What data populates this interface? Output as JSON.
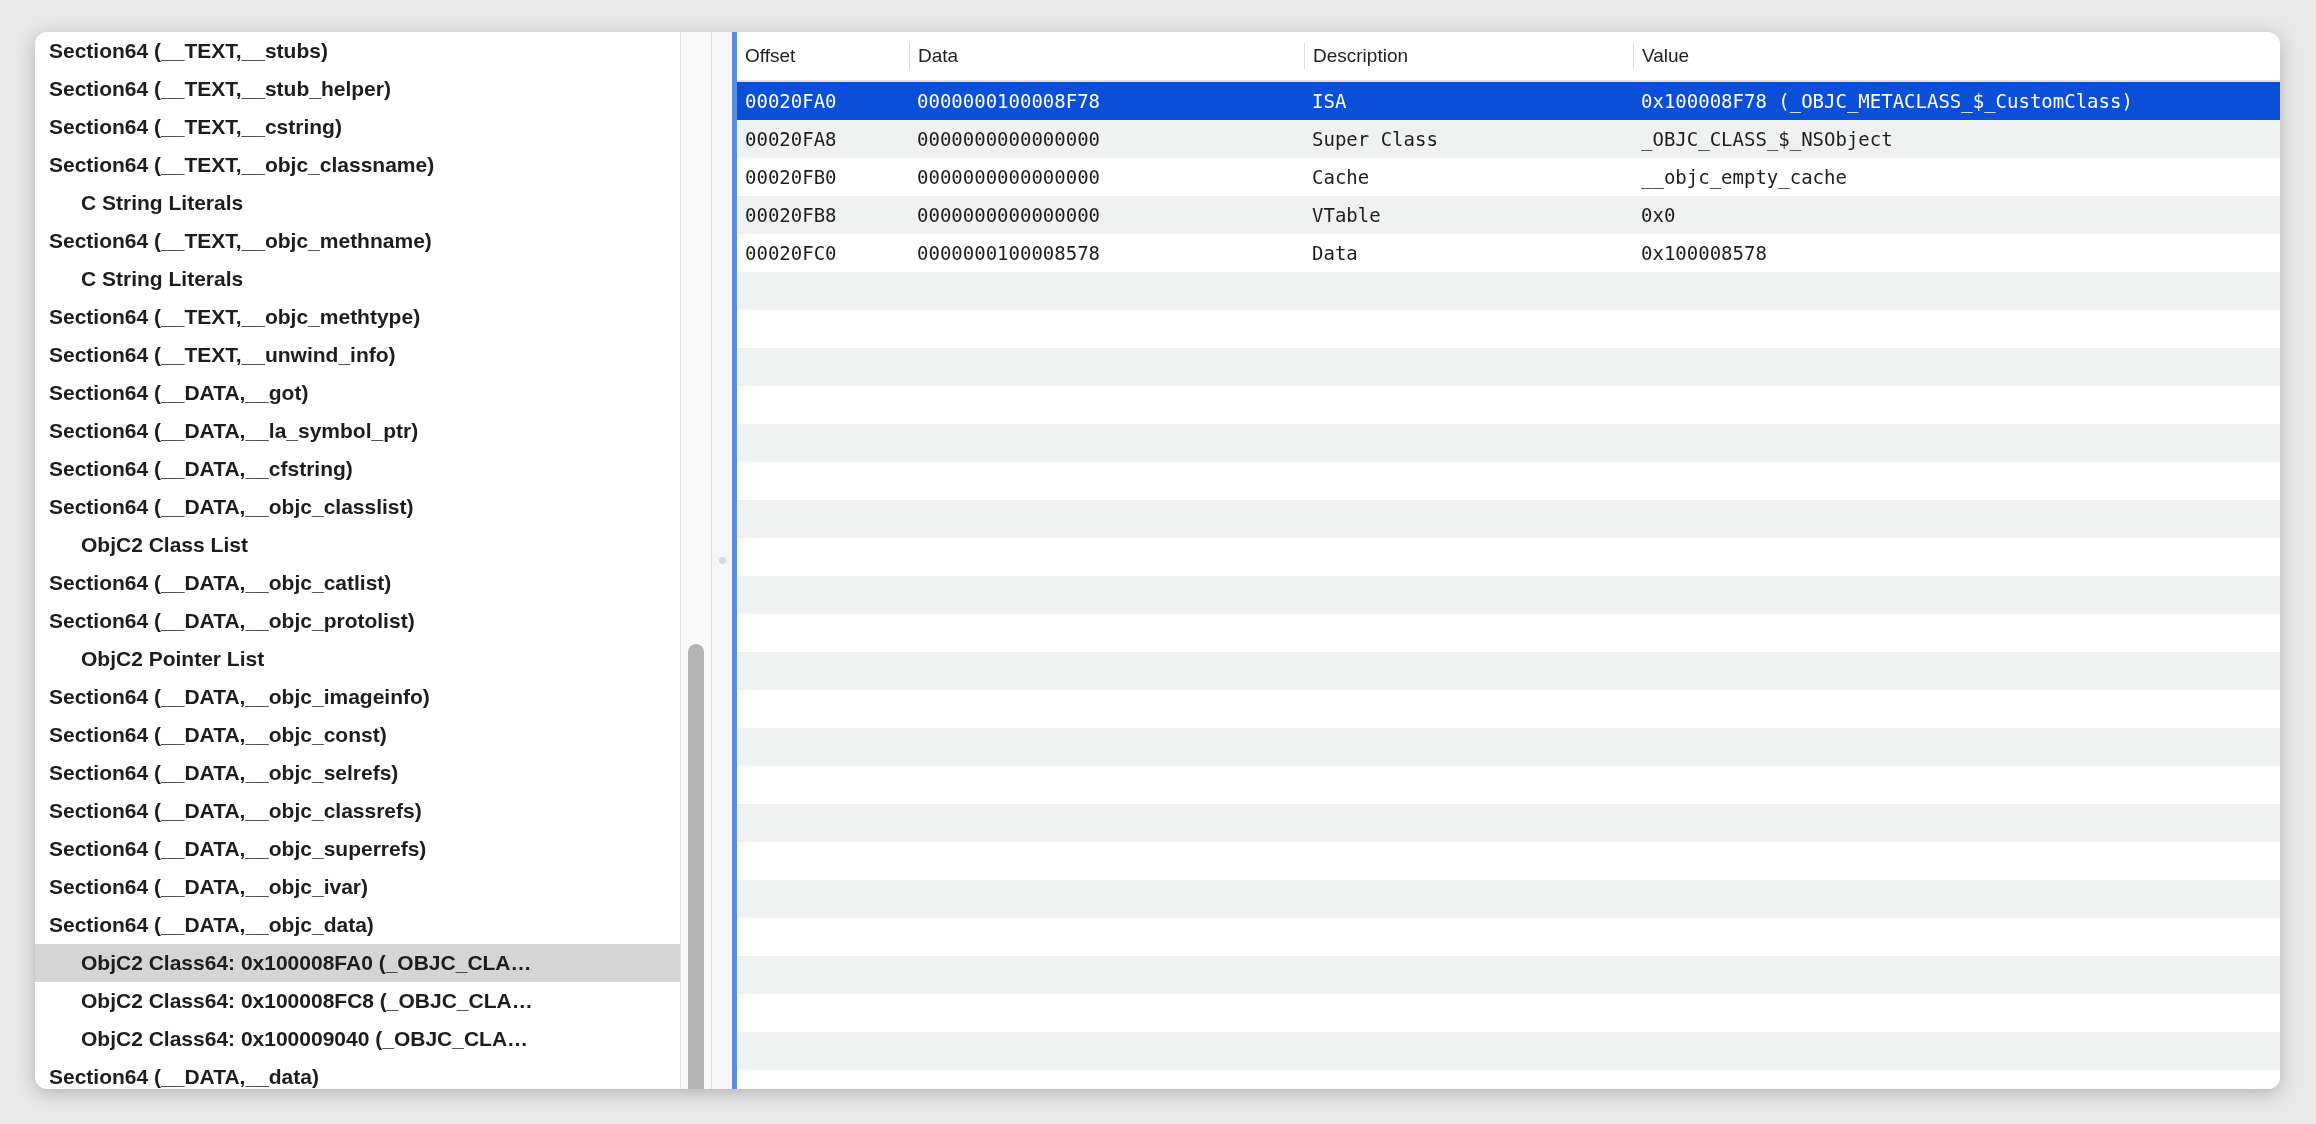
{
  "sidebar": {
    "items": [
      {
        "label": "Section64 (__TEXT,__stubs)",
        "selected": false
      },
      {
        "label": "Section64 (__TEXT,__stub_helper)",
        "selected": false
      },
      {
        "label": "Section64 (__TEXT,__cstring)",
        "selected": false
      },
      {
        "label": "Section64 (__TEXT,__objc_classname)",
        "selected": false,
        "children": [
          {
            "label": "C String Literals",
            "selected": false
          }
        ]
      },
      {
        "label": "Section64 (__TEXT,__objc_methname)",
        "selected": false,
        "children": [
          {
            "label": "C String Literals",
            "selected": false
          }
        ]
      },
      {
        "label": "Section64 (__TEXT,__objc_methtype)",
        "selected": false
      },
      {
        "label": "Section64 (__TEXT,__unwind_info)",
        "selected": false
      },
      {
        "label": "Section64 (__DATA,__got)",
        "selected": false
      },
      {
        "label": "Section64 (__DATA,__la_symbol_ptr)",
        "selected": false
      },
      {
        "label": "Section64 (__DATA,__cfstring)",
        "selected": false
      },
      {
        "label": "Section64 (__DATA,__objc_classlist)",
        "selected": false,
        "children": [
          {
            "label": "ObjC2 Class List",
            "selected": false
          }
        ]
      },
      {
        "label": "Section64 (__DATA,__objc_catlist)",
        "selected": false
      },
      {
        "label": "Section64 (__DATA,__objc_protolist)",
        "selected": false,
        "children": [
          {
            "label": "ObjC2 Pointer List",
            "selected": false
          }
        ]
      },
      {
        "label": "Section64 (__DATA,__objc_imageinfo)",
        "selected": false
      },
      {
        "label": "Section64 (__DATA,__objc_const)",
        "selected": false
      },
      {
        "label": "Section64 (__DATA,__objc_selrefs)",
        "selected": false
      },
      {
        "label": "Section64 (__DATA,__objc_classrefs)",
        "selected": false
      },
      {
        "label": "Section64 (__DATA,__objc_superrefs)",
        "selected": false
      },
      {
        "label": "Section64 (__DATA,__objc_ivar)",
        "selected": false
      },
      {
        "label": "Section64 (__DATA,__objc_data)",
        "selected": false,
        "children": [
          {
            "label": "ObjC2 Class64: 0x100008FA0 (_OBJC_CLA…",
            "selected": true
          },
          {
            "label": "ObjC2 Class64: 0x100008FC8 (_OBJC_CLA…",
            "selected": false
          },
          {
            "label": "ObjC2 Class64: 0x100009040 (_OBJC_CLA…",
            "selected": false
          }
        ]
      },
      {
        "label": "Section64 (__DATA,__data)",
        "selected": false
      }
    ]
  },
  "table": {
    "columns": [
      "Offset",
      "Data",
      "Description",
      "Value"
    ],
    "rows": [
      {
        "cells": [
          "00020FA0",
          "0000000100008F78",
          "ISA",
          "0x100008F78 (_OBJC_METACLASS_$_CustomClass)"
        ],
        "selected": true
      },
      {
        "cells": [
          "00020FA8",
          "0000000000000000",
          "Super Class",
          "_OBJC_CLASS_$_NSObject"
        ],
        "selected": false
      },
      {
        "cells": [
          "00020FB0",
          "0000000000000000",
          "Cache",
          "__objc_empty_cache"
        ],
        "selected": false
      },
      {
        "cells": [
          "00020FB8",
          "0000000000000000",
          "VTable",
          "0x0"
        ],
        "selected": false
      },
      {
        "cells": [
          "00020FC0",
          "0000000100008578",
          "Data",
          "0x100008578"
        ],
        "selected": false
      }
    ]
  }
}
